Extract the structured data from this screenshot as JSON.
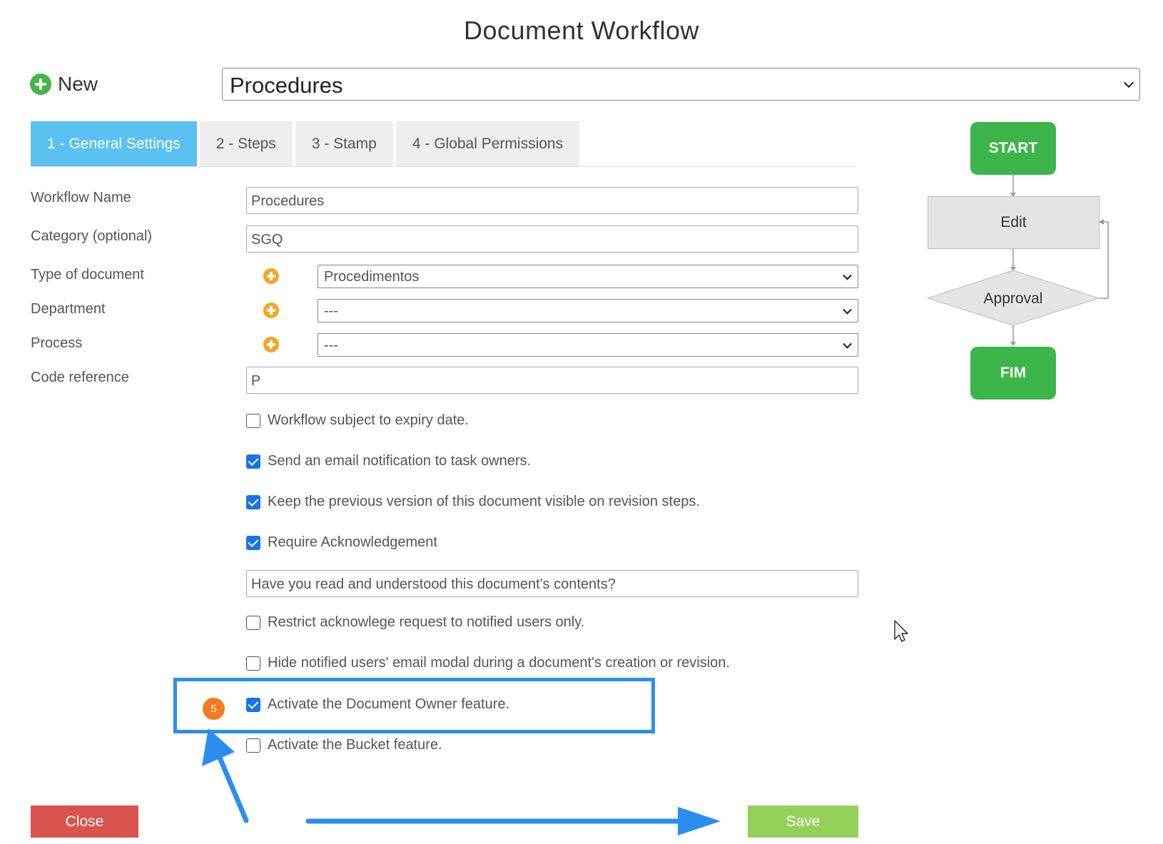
{
  "header": {
    "title": "Document Workflow"
  },
  "toolbar": {
    "new_label": "New",
    "workflow_select_value": "Procedures"
  },
  "tabs": [
    {
      "label": "1 - General Settings",
      "active": true
    },
    {
      "label": "2 - Steps",
      "active": false
    },
    {
      "label": "3 - Stamp",
      "active": false
    },
    {
      "label": "4 - Global Permissions",
      "active": false
    }
  ],
  "form": {
    "workflow_name": {
      "label": "Workflow Name",
      "value": "Procedures"
    },
    "category": {
      "label": "Category (optional)",
      "value": "SGQ"
    },
    "type_of_document": {
      "label": "Type of document",
      "value": "Procedimentos"
    },
    "department": {
      "label": "Department",
      "value": "---"
    },
    "process": {
      "label": "Process",
      "value": "---"
    },
    "code_reference": {
      "label": "Code reference",
      "value": "P"
    },
    "acknowledgement_question": "Have you read and understood this document's contents?"
  },
  "options": [
    {
      "label": "Workflow subject to expiry date.",
      "checked": false
    },
    {
      "label": "Send an email notification to task owners.",
      "checked": true
    },
    {
      "label": "Keep the previous version of this document visible on revision steps.",
      "checked": true
    },
    {
      "label": "Require Acknowledgement",
      "checked": true
    },
    {
      "label": "Restrict acknowlege request to notified users only.",
      "checked": false
    },
    {
      "label": "Hide notified users' email modal during a document's creation or revision.",
      "checked": false
    },
    {
      "label": "Activate the Document Owner feature.",
      "checked": true
    },
    {
      "label": "Activate the Bucket feature.",
      "checked": false
    }
  ],
  "annotation": {
    "step_badge": "5",
    "highlight_color": "#2c8df0",
    "badge_color": "#f47b20"
  },
  "buttons": {
    "close": "Close",
    "save": "Save"
  },
  "flowchart": {
    "start": "START",
    "edit": "Edit",
    "approval": "Approval",
    "end": "FIM"
  },
  "colors": {
    "tab_active": "#5bc0f2",
    "checkbox_checked": "#1a73e8",
    "close": "#d9534f",
    "save": "#95d05a",
    "flow_green": "#3cb54a",
    "add_icon": "#f5a623",
    "new_icon": "#43b649"
  }
}
